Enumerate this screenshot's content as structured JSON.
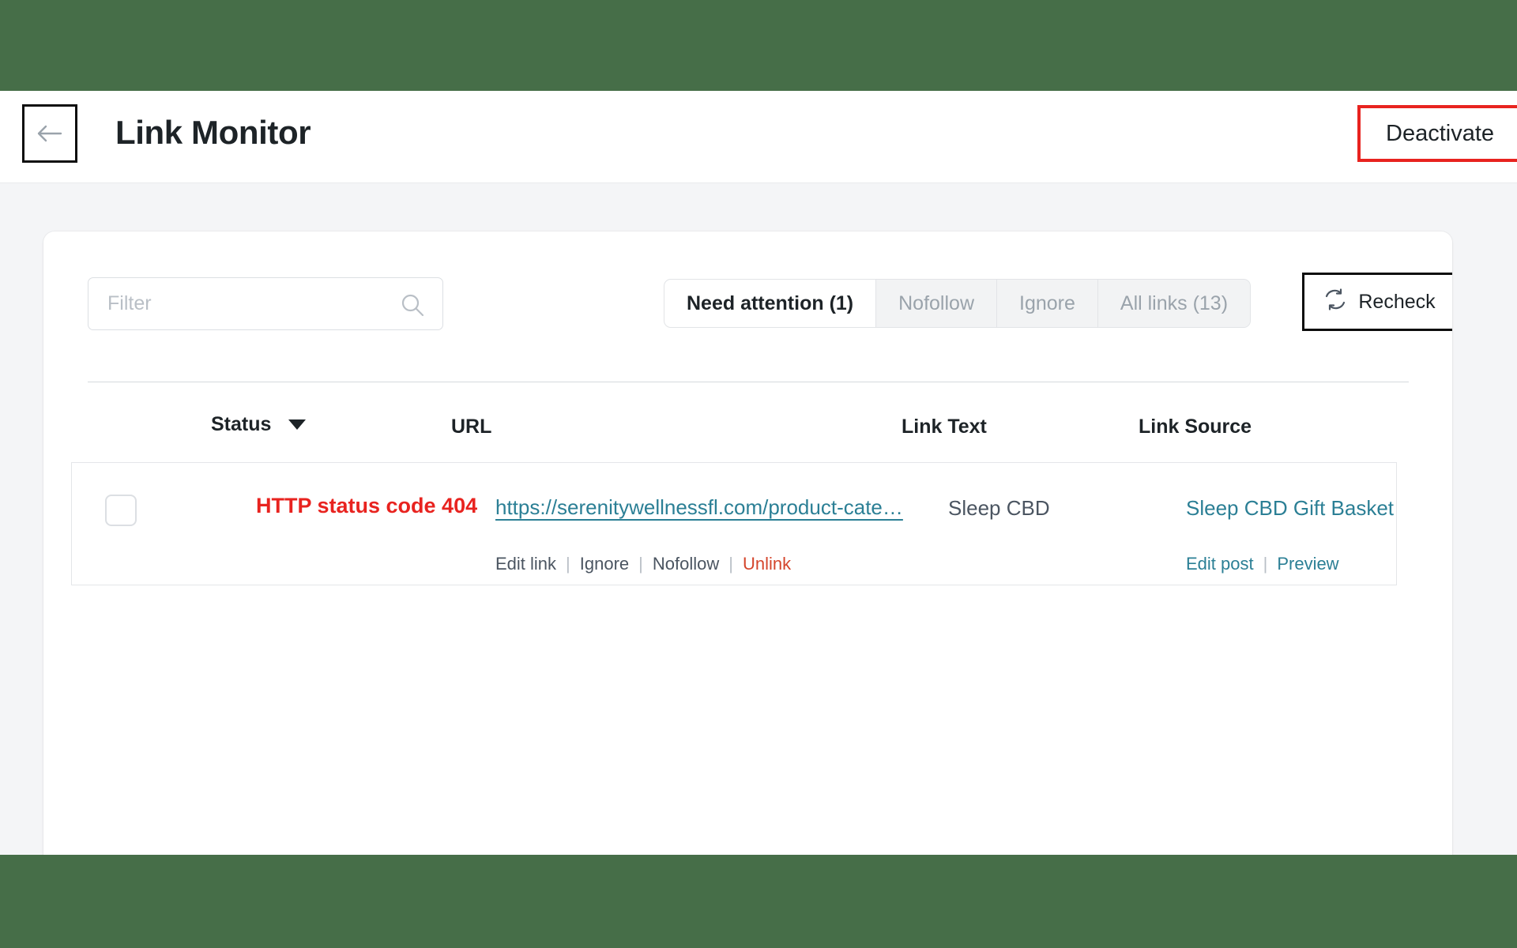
{
  "theme": {
    "chrome_green": "#466e48",
    "page_bg": "#f4f5f7",
    "card_bg": "#ffffff",
    "accent_teal": "#2b7f95",
    "danger_red": "#e8231f",
    "unlink_red": "#d4452c",
    "text_dark": "#1d2327",
    "text_muted": "#9aa3ab"
  },
  "header": {
    "back_icon": "arrow-left-icon",
    "title": "Link Monitor",
    "deactivate_label": "Deactivate"
  },
  "toolbar": {
    "filter": {
      "placeholder": "Filter",
      "value": "",
      "search_icon": "search-icon"
    },
    "tabs": [
      {
        "label": "Need attention (1)",
        "active": true
      },
      {
        "label": "Nofollow",
        "active": false
      },
      {
        "label": "Ignore",
        "active": false
      },
      {
        "label": "All links (13)",
        "active": false
      }
    ],
    "recheck": {
      "label": "Recheck",
      "icon": "refresh-icon"
    }
  },
  "table": {
    "columns": {
      "status": "Status",
      "url": "URL",
      "link_text": "Link Text",
      "link_source": "Link Source"
    },
    "sort_indicator": "chevron-down-icon",
    "rows": [
      {
        "checked": false,
        "status": "HTTP status code 404",
        "url": "https://serenitywellnessfl.com/product-cate…",
        "link_text": "Sleep CBD",
        "link_source": "Sleep CBD Gift Basket",
        "actions_left": [
          "Edit link",
          "Ignore",
          "Nofollow",
          "Unlink"
        ],
        "actions_right": [
          "Edit post",
          "Preview"
        ],
        "separator": "|"
      }
    ]
  }
}
